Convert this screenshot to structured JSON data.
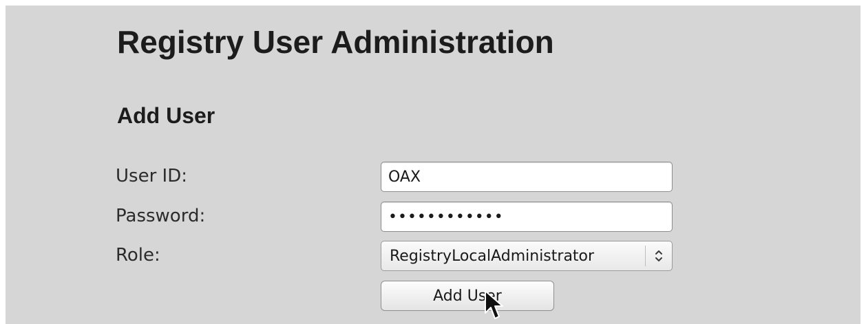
{
  "page": {
    "title": "Registry User Administration",
    "section_title": "Add User"
  },
  "form": {
    "user_id": {
      "label": "User ID:",
      "value": "OAX"
    },
    "password": {
      "label": "Password:",
      "value": "••••••••••••"
    },
    "role": {
      "label": "Role:",
      "selected": "RegistryLocalAdministrator"
    },
    "submit_label": "Add User"
  },
  "icons": {
    "select_arrow": "up-down-chevron-icon",
    "cursor": "mouse-pointer-icon"
  },
  "colors": {
    "panel_background": "#d6d6d6",
    "text": "#1c1c1c"
  }
}
